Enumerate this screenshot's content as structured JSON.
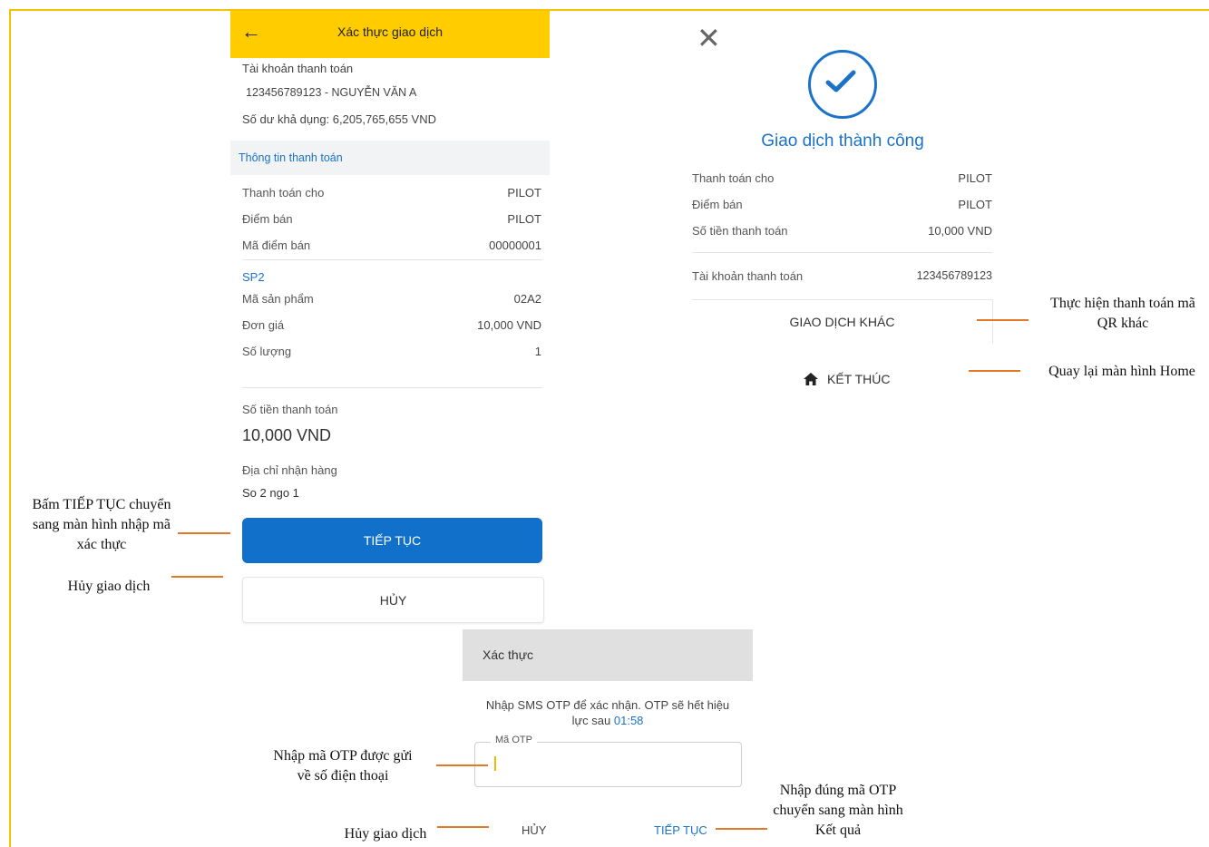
{
  "confirm_screen": {
    "title": "Xác thực giao dịch",
    "account_label": "Tài khoản thanh toán",
    "account_value": "123456789123 - NGUYỄN VĂN A",
    "balance_label": "Số dư khả dụng:",
    "balance_value": "6,205,765,655 VND",
    "section_title": "Thông tin thanh toán",
    "rows": [
      {
        "label": "Thanh toán cho",
        "value": "PILOT"
      },
      {
        "label": "Điểm bán",
        "value": "PILOT"
      },
      {
        "label": "Mã điểm bán",
        "value": "00000001"
      }
    ],
    "product_name": "SP2",
    "product_rows": [
      {
        "label": "Mã sản phẩm",
        "value": "02A2"
      },
      {
        "label": "Đơn giá",
        "value": "10,000 VND"
      },
      {
        "label": "Số lượng",
        "value": "1"
      }
    ],
    "amount_label": "Số tiền thanh toán",
    "amount_value": "10,000 VND",
    "address_label": "Địa chỉ nhận hàng",
    "address_value": "So 2 ngo 1",
    "continue_label": "TIẾP TỤC",
    "cancel_label": "HỦY"
  },
  "result_screen": {
    "success_title": "Giao dịch thành công",
    "rows": [
      {
        "label": "Thanh toán cho",
        "value": "PILOT"
      },
      {
        "label": "Điểm bán",
        "value": "PILOT"
      },
      {
        "label": "Số tiền thanh toán",
        "value": "10,000 VND"
      }
    ],
    "account_label": "Tài khoản thanh toán",
    "account_value": "123456789123",
    "other_label": "GIAO DỊCH KHÁC",
    "end_label": "KẾT THÚC"
  },
  "otp_dialog": {
    "title": "Xác thực",
    "message": "Nhập SMS OTP để xác nhận. OTP sẽ hết hiệu",
    "message2": "lực sau",
    "countdown": "01:58",
    "field_label": "Mã OTP",
    "field_value": "",
    "cancel_label": "HỦY",
    "continue_label": "TIẾP TỤC"
  },
  "annotations": {
    "continue_note": [
      "Bấm TIẾP TỤC chuyển",
      "sang màn hình nhập mã",
      "xác thực"
    ],
    "cancel_note": "Hủy giao dịch",
    "other_note": [
      "Thực hiện thanh toán mã",
      "QR khác"
    ],
    "home_note": "Quay lại màn hình Home",
    "otp_note": [
      "Nhập mã OTP được gửi",
      "về số điện thoại"
    ],
    "otp_cancel_note": "Hủy giao dịch",
    "otp_next_note": [
      "Nhập đúng mã OTP",
      "chuyển sang màn hình",
      "Kết quả"
    ]
  },
  "colors": {
    "header_yellow": "#ffcc00",
    "primary_blue": "#1170c9",
    "annotation_line": "#e07a2a"
  },
  "icons": [
    "back-arrow-icon",
    "close-icon",
    "check-circle-icon",
    "home-icon"
  ]
}
